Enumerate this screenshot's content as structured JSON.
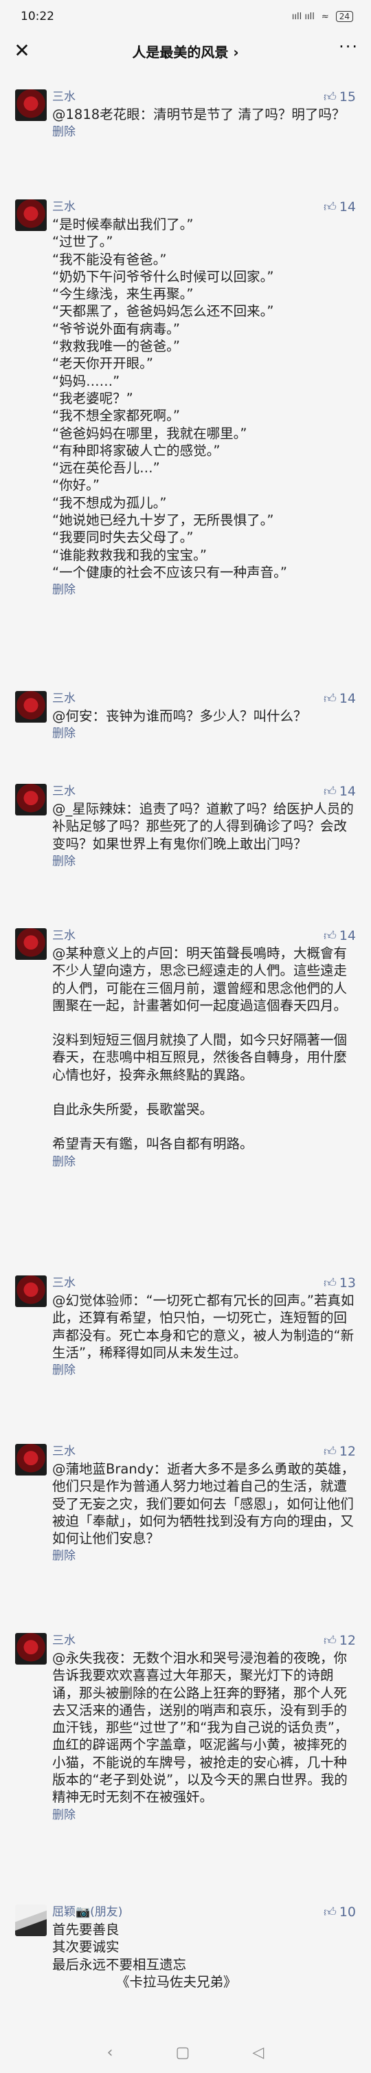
{
  "status": {
    "time": "10:22",
    "signal": "ııll ııll",
    "wifi": "≈",
    "battery": "24"
  },
  "header": {
    "title": "人是最美的风景 ›"
  },
  "comments": [
    {
      "author": "三水",
      "likes": "15",
      "paragraphs": [
        "@1818老花眼：清明节是节了 清了吗？明了吗？"
      ],
      "delete": "删除"
    },
    {
      "author": "三水",
      "likes": "14",
      "paragraphs": [
        "“是时候奉献出我们了。”\n“过世了。”\n“我不能没有爸爸。”\n“奶奶下午问爷爷什么时候可以回家。”\n“今生缘浅，来生再聚。”\n“天都黑了，爸爸妈妈怎么还不回来。”\n“爷爷说外面有病毒。”\n“救救我唯一的爸爸。”\n“老天你开开眼。”\n“妈妈……”\n“我老婆呢？”\n“我不想全家都死啊。”\n“爸爸妈妈在哪里，我就在哪里。”\n“有种即将家破人亡的感觉。”\n“远在英伦吾儿…”\n“你好。”\n“我不想成为孤儿。”\n“她说她已经九十岁了，无所畏惧了。”\n“我要同时失去父母了。”\n“谁能救救我和我的宝宝。”\n“一个健康的社会不应该只有一种声音。”"
      ],
      "delete": "删除"
    },
    {
      "author": "三水",
      "likes": "14",
      "paragraphs": [
        "@何安：丧钟为谁而鸣？多少人？叫什么？"
      ],
      "delete": "删除"
    },
    {
      "author": "三水",
      "likes": "14",
      "paragraphs": [
        "@_星际辣妹：追责了吗？道歉了吗？给医护人员的补贴足够了吗？那些死了的人得到确诊了吗？会改变吗？如果世界上有鬼你们晚上敢出门吗？"
      ],
      "delete": "删除"
    },
    {
      "author": "三水",
      "likes": "14",
      "paragraphs": [
        "@某种意义上的卢回：明天笛聲長鳴時，大概會有不少人望向遠方，思念已經遠走的人們。這些遠走的人們，可能在三個月前，還曾經和思念他們的人團聚在一起，計畫著如何一起度過這個春天四月。",
        "沒料到短短三個月就換了人間，如今只好隔著一個春天，在悲鳴中相互照見，然後各自轉身，用什麼心情也好，投奔永無終點的異路。",
        "自此永失所愛，長歌當哭。",
        "希望青天有鑑，叫各自都有明路。"
      ],
      "delete": "删除"
    },
    {
      "author": "三水",
      "likes": "13",
      "paragraphs": [
        "@幻觉体验师：“一切死亡都有冗长的回声。”若真如此，还算有希望，怕只怕，一切死亡，连短暂的回声都没有。死亡本身和它的意义，被人为制造的“新生活”，稀释得如同从未发生过。"
      ],
      "delete": "删除"
    },
    {
      "author": "三水",
      "likes": "12",
      "paragraphs": [
        "@蒲地蓝Brandy：逝者大多不是多么勇敢的英雄，他们只是作为普通人努力地过着自己的生活，就遭受了无妄之灾，我们要如何去「感恩」，如何让他们被迫「奉献」，如何为牺牲找到没有方向的理由，又如何让他们安息？"
      ],
      "delete": "删除"
    },
    {
      "author": "三水",
      "likes": "12",
      "paragraphs": [
        "@永失我夜：无数个泪水和哭号浸泡着的夜晚，你告诉我要欢欢喜喜过大年那天，聚光灯下的诗朗诵，那头被删除的在公路上狂奔的野猪，那个人死去又活来的通告，送别的哨声和哀乐，没有到手的血汗钱，那些“过世了”和“我为自己说的话负责”，血红的辟谣两个字盖章，呕泥酱与小黄，被摔死的小猫，不能说的车牌号，被抢走的安心裤，几十种版本的“老子到处说”，以及今天的黑白世界。我的精神无时无刻不在被强奸。"
      ],
      "delete": "删除"
    },
    {
      "author": "屈颖📷(朋友)",
      "likes": "10",
      "friend": true,
      "paragraphs": [
        "首先要善良\n其次要诚实\n最后永远不要相互遗忘\n               《卡拉马佐夫兄弟》"
      ],
      "delete": ""
    }
  ],
  "navbar": {
    "back": "‹",
    "home": "▢",
    "recent": "◁"
  }
}
